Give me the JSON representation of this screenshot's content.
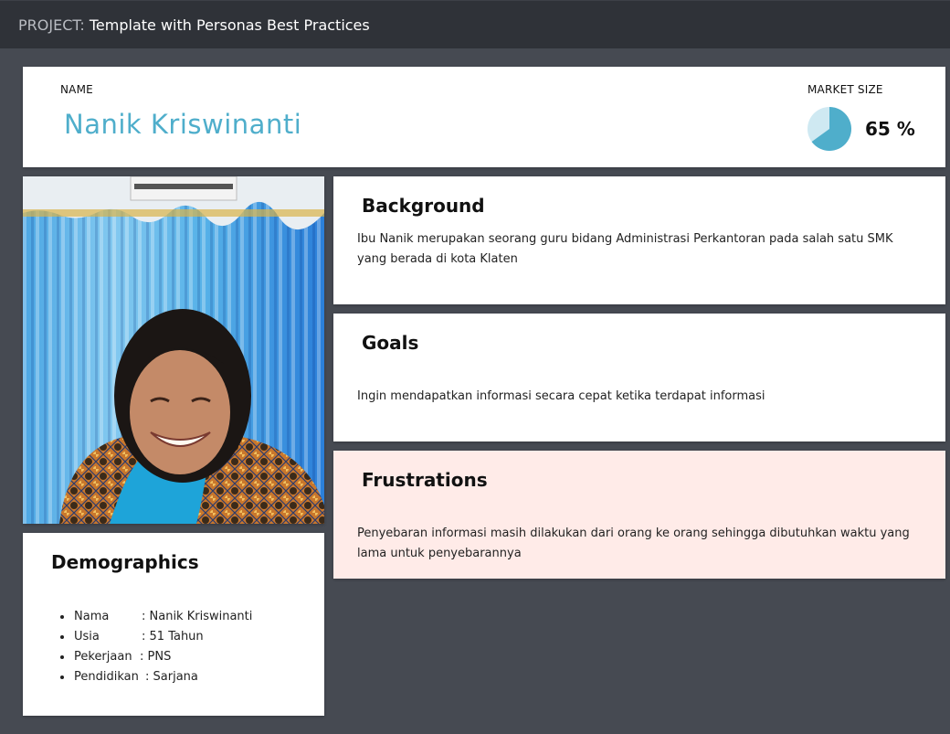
{
  "header": {
    "project_prefix": "PROJECT:",
    "project_title": "Template with Personas Best Practices"
  },
  "persona": {
    "name_label": "NAME",
    "name": "Nanik Kriswinanti",
    "market_size_label": "MARKET SIZE",
    "market_size_value": "65 %",
    "market_size_fraction": 0.65
  },
  "photo": {
    "alt": "Nanik Kriswinanti"
  },
  "sections": {
    "background": {
      "title": "Background",
      "text": "Ibu Nanik merupakan seorang guru bidang Administrasi Perkantoran pada salah satu SMK yang berada di kota Klaten"
    },
    "goals": {
      "title": "Goals",
      "text": "Ingin mendapatkan informasi secara cepat ketika terdapat informasi"
    },
    "frustrations": {
      "title": "Frustrations",
      "text": "Penyebaran informasi masih dilakukan dari orang ke orang sehingga dibutuhkan waktu yang lama untuk penyebarannya"
    }
  },
  "demographics": {
    "title": "Demographics",
    "items": [
      {
        "label": "Nama",
        "sep": ": ",
        "value": "Nanik Kriswinanti"
      },
      {
        "label": "Usia",
        "sep": ": ",
        "value": "51 Tahun"
      },
      {
        "label": "Pekerjaan",
        "sep": ": ",
        "value": "PNS"
      },
      {
        "label": "Pendidikan",
        "sep": ": ",
        "value": "Sarjana"
      }
    ]
  },
  "colors": {
    "accent": "#4faecb",
    "pie_light": "#cfe9f2",
    "frustrations_bg": "#ffebe8",
    "background": "#464a52",
    "topbar": "#2f3238"
  }
}
